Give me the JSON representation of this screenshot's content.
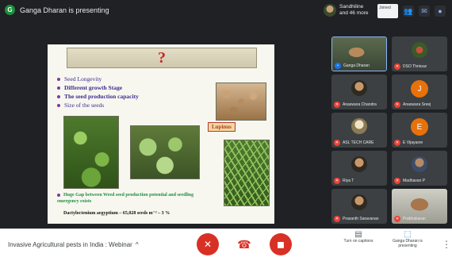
{
  "topbar": {
    "presenter_initial": "G",
    "presenter_text": "Ganga Dharan is presenting",
    "viewers_line1": "Sandhiline",
    "viewers_line2": "and 46 more",
    "card_text": "Joined"
  },
  "slide": {
    "title": "?",
    "bullets": [
      "Seed Longevity",
      "Different growth Stage",
      "The seed production capacity",
      "Size of the seeds"
    ],
    "image_label": "Lupinus",
    "gap_text": "Huge Gap between Weed seed production potential and seedling emergency exists",
    "stat_text": "Dactyloctenium aegyptium – 65,028 seeds m⁻² – 3 %"
  },
  "participants": [
    {
      "name": "Ganga Dharan",
      "type": "cam",
      "active": true
    },
    {
      "name": "DSO Thrissur",
      "type": "photo"
    },
    {
      "name": "Anaswara Chandra",
      "type": "face"
    },
    {
      "name": "Anaswara Sreej",
      "type": "initial",
      "initial": "J",
      "color": "#e8710a"
    },
    {
      "name": "ASL TECH CARE",
      "type": "face"
    },
    {
      "name": "E Vijayasre",
      "type": "initial",
      "initial": "E",
      "color": "#e8710a"
    },
    {
      "name": "Riya T",
      "type": "face"
    },
    {
      "name": "Madhavan P",
      "type": "face"
    },
    {
      "name": "Prasanth Saravanan",
      "type": "face"
    },
    {
      "name": "Prabhakaran",
      "type": "cam2"
    }
  ],
  "bottombar": {
    "meeting_title": "Invasive Agricultural pests in India : Webinar",
    "chevron": "^",
    "controls": [
      {
        "icon": "mic-off-icon",
        "glyph": "✕"
      },
      {
        "icon": "hang-up-icon",
        "glyph": "☎"
      },
      {
        "icon": "camera-off-icon",
        "glyph": "◼"
      }
    ],
    "right": [
      {
        "label": "Turn on captions",
        "glyph": "▤"
      },
      {
        "label": "Ganga Dharan is presenting",
        "glyph": "⬚"
      }
    ],
    "more": "⋮"
  },
  "colors": {
    "background": "#1f2125",
    "mic_red": "#ea4335",
    "accent_blue": "#8ab4f8",
    "slide_title_red": "#c62828",
    "bullet_purple": "#3d2b8c",
    "gap_green": "#1e8e3e"
  }
}
